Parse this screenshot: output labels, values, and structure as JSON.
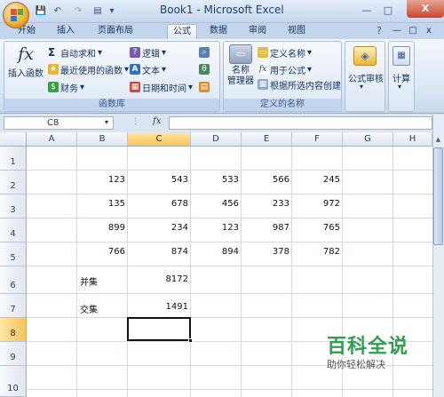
{
  "window": {
    "title": "Book1 - Microsoft Excel"
  },
  "quick_access": {
    "save": "💾",
    "undo": "↶",
    "redo": "↷",
    "more": "▾"
  },
  "window_controls": {
    "minimize": "—",
    "maximize": "□",
    "close": "X"
  },
  "tabs": [
    "开始",
    "插入",
    "页面布局",
    "公式",
    "数据",
    "审阅",
    "视图"
  ],
  "active_tab": "公式",
  "ribbon": {
    "function_library": {
      "insert_function": {
        "symbol": "fx",
        "label": "插入函数"
      },
      "autosum": "自动求和",
      "recent": "最近使用的函数",
      "financial": "财务",
      "logical": "逻辑",
      "text": "文本",
      "datetime": "日期和时间",
      "group_label": "函数库"
    },
    "defined_names": {
      "name_manager": "名称\n管理器",
      "define_name": "定义名称",
      "use_in_formula": "用于公式",
      "create_from_selection": "根据所选内容创建",
      "group_label": "定义的名称"
    },
    "formula_auditing": {
      "label": "公式审核"
    },
    "calculation": {
      "label": "计算"
    }
  },
  "formula_bar": {
    "name_box": "C8",
    "fx": "fx",
    "formula": ""
  },
  "sheet": {
    "columns": [
      "A",
      "B",
      "C",
      "D",
      "E",
      "F",
      "G",
      "H"
    ],
    "rows": [
      "1",
      "2",
      "3",
      "4",
      "5",
      "6",
      "7",
      "8",
      "9",
      "10"
    ],
    "selected_cell": "C8",
    "cells": [
      [
        "",
        "",
        "",
        "",
        "",
        "",
        ""
      ],
      [
        "",
        "123",
        "543",
        "533",
        "566",
        "245",
        ""
      ],
      [
        "",
        "135",
        "678",
        "456",
        "233",
        "972",
        ""
      ],
      [
        "",
        "899",
        "234",
        "123",
        "987",
        "765",
        ""
      ],
      [
        "",
        "766",
        "874",
        "894",
        "378",
        "782",
        ""
      ],
      [
        "",
        "并集",
        "8172",
        "",
        "",
        "",
        ""
      ],
      [
        "",
        "交集",
        "1491",
        "",
        "",
        "",
        ""
      ],
      [
        "",
        "",
        "",
        "",
        "",
        "",
        ""
      ],
      [
        "",
        "",
        "",
        "",
        "",
        "",
        ""
      ],
      [
        "",
        "",
        "",
        "",
        "",
        "",
        ""
      ]
    ]
  },
  "watermark": {
    "brand": "百科全说",
    "tagline": "助你轻松解决"
  }
}
